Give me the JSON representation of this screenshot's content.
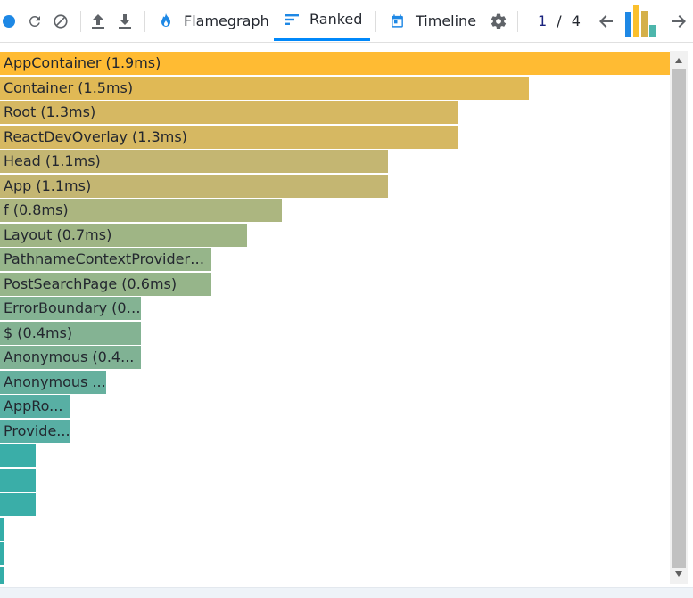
{
  "toolbar": {
    "tabs": [
      {
        "label": "Flamegraph",
        "icon": "flame-icon",
        "active": false
      },
      {
        "label": "Ranked",
        "icon": "ranked-icon",
        "active": true
      },
      {
        "label": "Timeline",
        "icon": "calendar-icon",
        "active": false
      }
    ],
    "pager": {
      "current": "1",
      "separator": "/",
      "total": "4"
    },
    "accent_color": "#0088fa"
  },
  "commit_bars": [
    {
      "value": 0.78,
      "color": "#1e88e5"
    },
    {
      "value": 1.0,
      "color": "#fbc02d"
    },
    {
      "value": 0.82,
      "color": "#d4b04a"
    },
    {
      "value": 0.38,
      "color": "#4db6ac"
    }
  ],
  "ranked": {
    "rows": [
      {
        "label": "AppContainer (1.9ms)",
        "value": 1.9,
        "color": "#ffbb33",
        "text": "AppContainer (1.9ms)"
      },
      {
        "label": "Container (1.5ms)",
        "value": 1.5,
        "color": "#e0b955",
        "text": "Container (1.5ms)"
      },
      {
        "label": "Root (1.3ms)",
        "value": 1.3,
        "color": "#d6b862",
        "text": "Root (1.3ms)"
      },
      {
        "label": "ReactDevOverlay (1.3ms)",
        "value": 1.3,
        "color": "#d6b862",
        "text": "ReactDevOverlay (1.3ms)"
      },
      {
        "label": "Head (1.1ms)",
        "value": 1.1,
        "color": "#c4b672",
        "text": "Head (1.1ms)"
      },
      {
        "label": "App (1.1ms)",
        "value": 1.1,
        "color": "#c4b672",
        "text": "App (1.1ms)"
      },
      {
        "label": "f (0.8ms)",
        "value": 0.8,
        "color": "#acb680",
        "text": "f (0.8ms)"
      },
      {
        "label": "Layout (0.7ms)",
        "value": 0.7,
        "color": "#9fb585",
        "text": "Layout (0.7ms)"
      },
      {
        "label": "PathnameContextProviderA...",
        "value": 0.6,
        "color": "#96b58a",
        "text": "PathnameContextProviderA..."
      },
      {
        "label": "PostSearchPage (0.6ms)",
        "value": 0.6,
        "color": "#96b58a",
        "text": "PostSearchPage (0.6ms)"
      },
      {
        "label": "ErrorBoundary (0....",
        "value": 0.4,
        "color": "#84b393",
        "text": "ErrorBoundary (0...."
      },
      {
        "label": "$ (0.4ms)",
        "value": 0.4,
        "color": "#84b393",
        "text": "$ (0.4ms)"
      },
      {
        "label": "Anonymous (0.4...",
        "value": 0.4,
        "color": "#80b294",
        "text": "Anonymous (0.4..."
      },
      {
        "label": "Anonymous ...",
        "value": 0.3,
        "color": "#66b09e",
        "text": "Anonymous ..."
      },
      {
        "label": "AppRo...",
        "value": 0.2,
        "color": "#58afa4",
        "text": "AppRo..."
      },
      {
        "label": "Provide...",
        "value": 0.2,
        "color": "#58afa4",
        "text": "Provide..."
      },
      {
        "label": "",
        "value": 0.1,
        "color": "#3aaea8",
        "text": ""
      },
      {
        "label": "",
        "value": 0.1,
        "color": "#3aaea8",
        "text": ""
      },
      {
        "label": "",
        "value": 0.1,
        "color": "#3aaea8",
        "text": ""
      },
      {
        "label": "",
        "value": 0.01,
        "color": "#34ada8",
        "text": ""
      },
      {
        "label": "",
        "value": 0.01,
        "color": "#34ada8",
        "text": ""
      },
      {
        "label": "",
        "value": 0.01,
        "color": "#34ada8",
        "text": ""
      }
    ]
  }
}
